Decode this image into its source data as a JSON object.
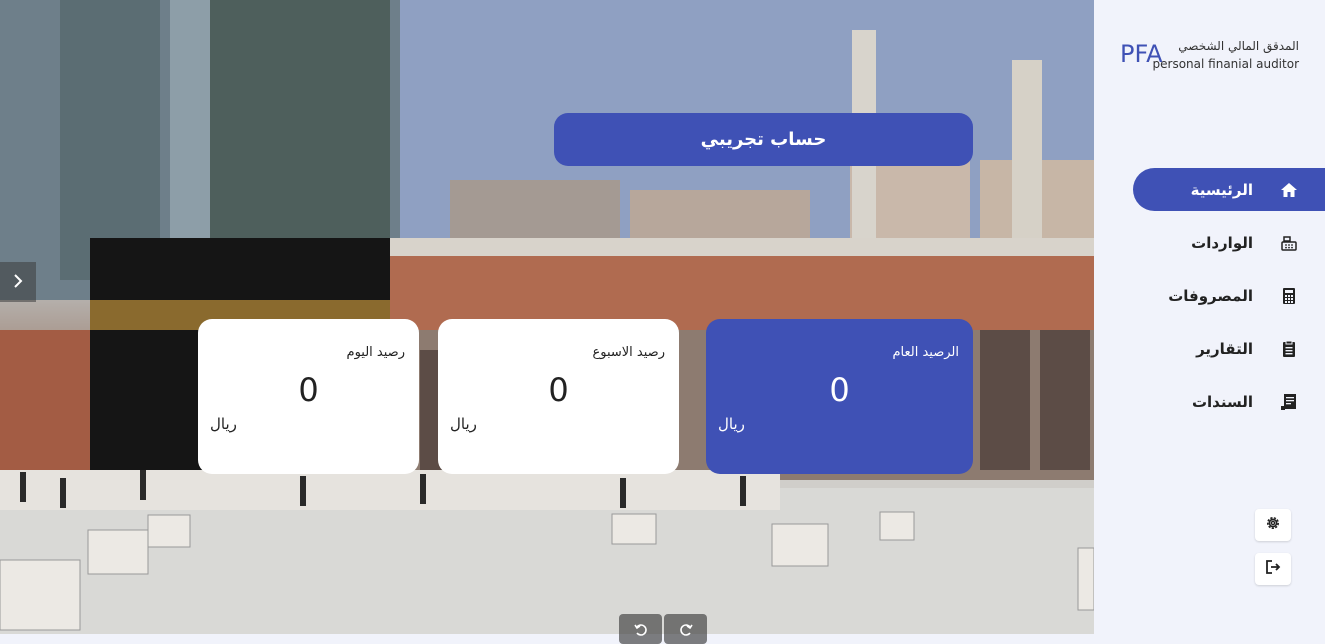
{
  "brand": {
    "short": "PFA",
    "name_ar": "المدقق المالي الشخصي",
    "name_en": "personal finanial auditor"
  },
  "account": {
    "title": "حساب تجريبي"
  },
  "cards": {
    "today": {
      "label": "رصيد اليوم",
      "amount": "0",
      "currency": "ريال"
    },
    "week": {
      "label": "رصيد الاسبوع",
      "amount": "0",
      "currency": "ريال"
    },
    "total": {
      "label": "الرصيد العام",
      "amount": "0",
      "currency": "ريال"
    }
  },
  "nav": {
    "items": [
      {
        "label": "الرئيسية",
        "icon": "home-icon",
        "active": true
      },
      {
        "label": "الواردات",
        "icon": "cash-register-icon",
        "active": false
      },
      {
        "label": "المصروفات",
        "icon": "calculator-icon",
        "active": false
      },
      {
        "label": "التقارير",
        "icon": "clipboard-icon",
        "active": false
      },
      {
        "label": "السندات",
        "icon": "receipt-icon",
        "active": false
      }
    ]
  },
  "utilities": {
    "settings_icon": "gear-icon",
    "logout_icon": "logout-icon"
  },
  "colors": {
    "primary": "#3f51b5",
    "sidebar_bg": "#f1f3fb",
    "card_bg": "#ffffff"
  }
}
